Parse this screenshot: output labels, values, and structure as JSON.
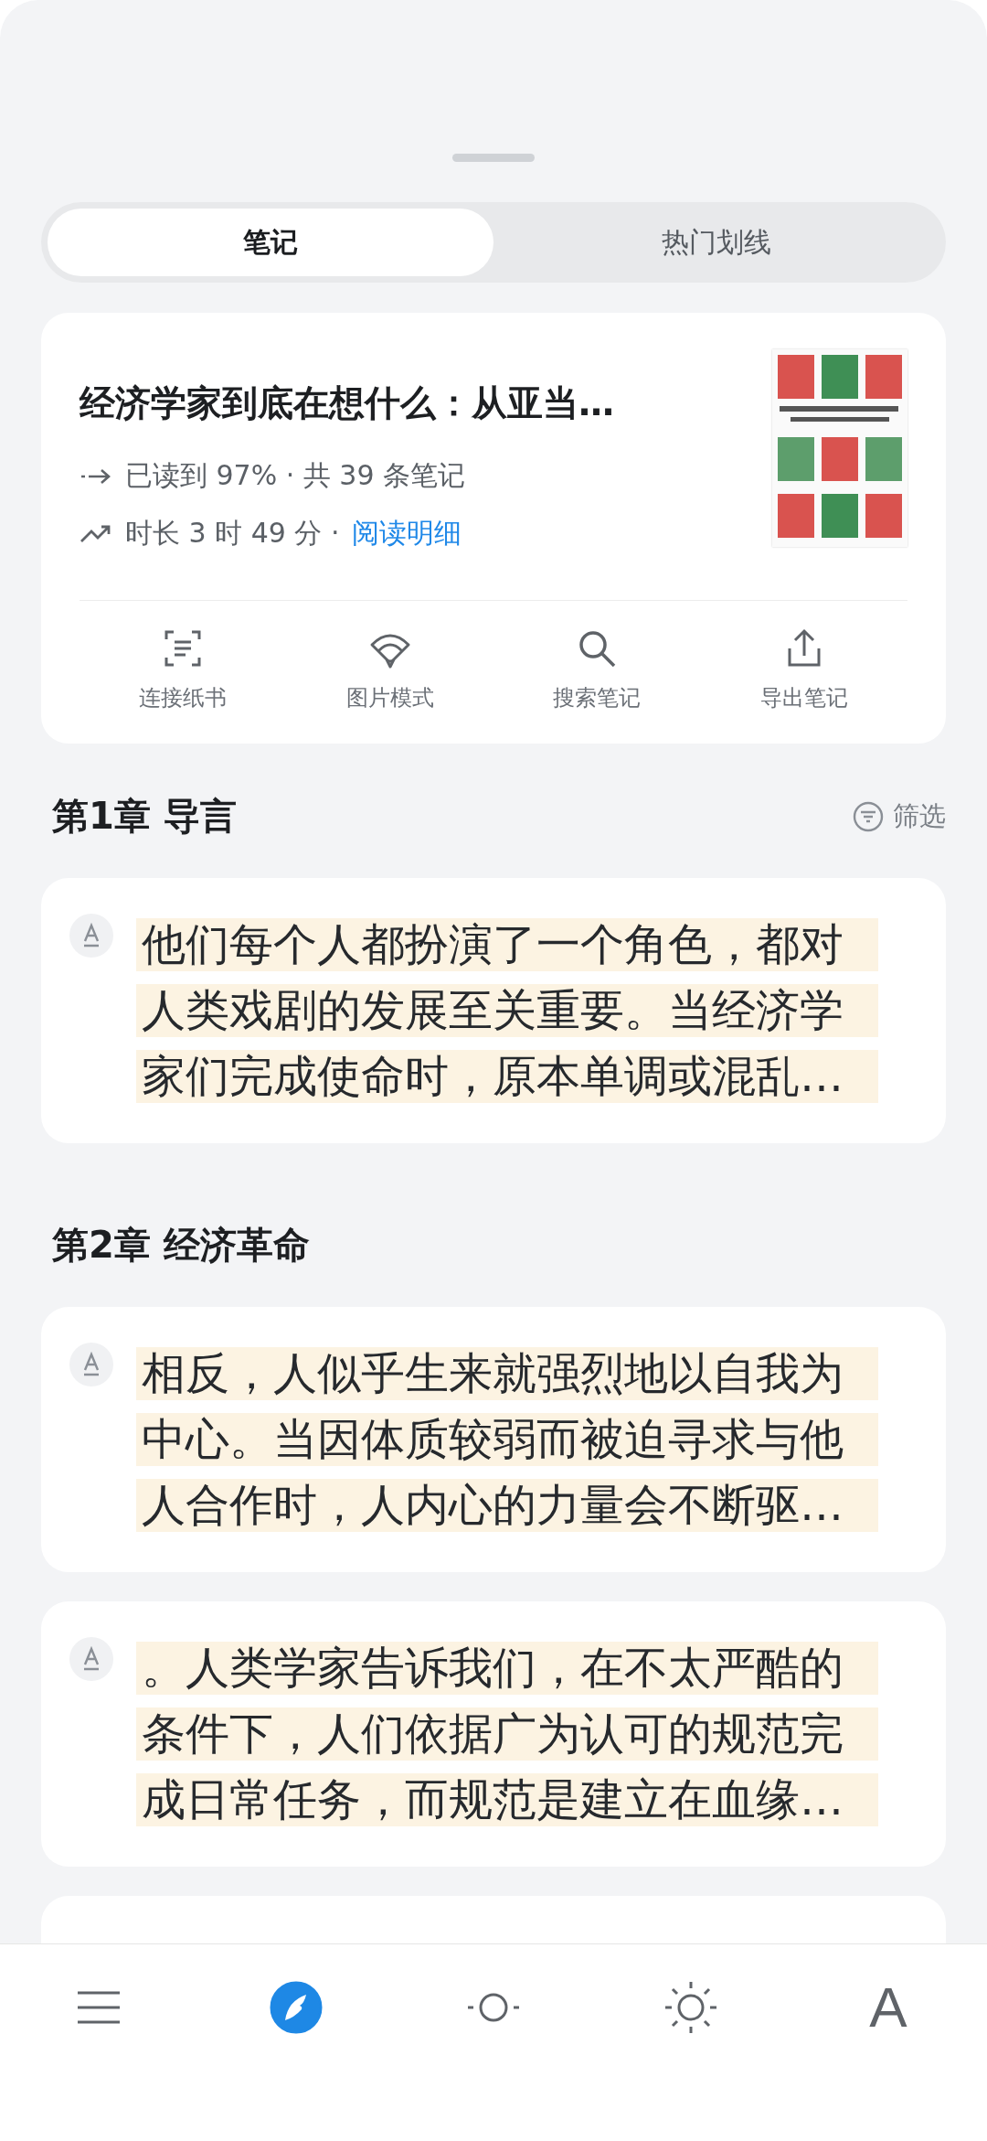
{
  "tabs": [
    {
      "label": "笔记",
      "selected": true
    },
    {
      "label": "热门划线",
      "selected": false
    }
  ],
  "book": {
    "title": "经济学家到底在想什么：从亚当…",
    "progress": "已读到 97% · 共 39 条笔记",
    "duration": "时长 3 时 49 分 ·",
    "detail_link": "阅读明细",
    "actions": [
      {
        "kind": "scan",
        "label": "连接纸书"
      },
      {
        "kind": "fan",
        "label": "图片模式"
      },
      {
        "kind": "search",
        "label": "搜索笔记"
      },
      {
        "kind": "export",
        "label": "导出笔记"
      }
    ]
  },
  "chapters": [
    {
      "title": "第1章 导言",
      "filter": "筛选",
      "notes": [
        {
          "text": "他们每个人都扮演了一个角色，都对人类戏剧的发展至关重要。当经济学家们完成使命时，原本单调或混乱…"
        }
      ]
    },
    {
      "title": "第2章 经济革命",
      "notes": [
        {
          "text": "相反，人似乎生来就强烈地以自我为中心。当因体质较弱而被迫寻求与他人合作时，人内心的力量会不断驱…"
        },
        {
          "text": "。人类学家告诉我们，在不太严酷的条件下，人们依据广为认可的规范完成日常任务，而规范是建立在血缘…"
        },
        {
          "kind": "covered"
        }
      ]
    }
  ],
  "toolbar": [
    {
      "kind": "menu",
      "selected": false
    },
    {
      "kind": "notes",
      "selected": true
    },
    {
      "kind": "progress",
      "selected": false
    },
    {
      "kind": "brightness",
      "selected": false
    },
    {
      "kind": "font",
      "label": "A",
      "selected": false
    }
  ]
}
